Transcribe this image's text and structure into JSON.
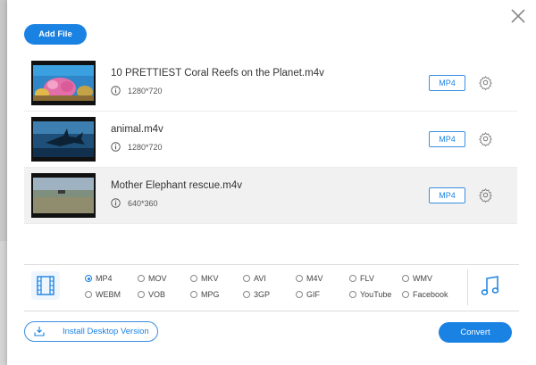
{
  "toolbar": {
    "add_file_label": "Add File"
  },
  "files": [
    {
      "name": "10 PRETTIEST Coral Reefs on the Planet.m4v",
      "resolution": "1280*720",
      "format": "MP4"
    },
    {
      "name": "animal.m4v",
      "resolution": "1280*720",
      "format": "MP4"
    },
    {
      "name": "Mother Elephant rescue.m4v",
      "resolution": "640*360",
      "format": "MP4"
    }
  ],
  "output_formats": {
    "selected": "MP4",
    "row1": [
      "MP4",
      "MOV",
      "MKV",
      "AVI",
      "M4V",
      "FLV",
      "WMV"
    ],
    "row2": [
      "WEBM",
      "VOB",
      "MPG",
      "3GP",
      "GIF",
      "YouTube",
      "Facebook"
    ]
  },
  "footer": {
    "install_label": "Install Desktop Version",
    "convert_label": "Convert"
  },
  "colors": {
    "accent": "#1a82e2",
    "selected_row": "#f1f1f1"
  },
  "icons": [
    "close-icon",
    "info-icon",
    "gear-icon",
    "video-format-icon",
    "music-note-icon",
    "download-icon"
  ]
}
